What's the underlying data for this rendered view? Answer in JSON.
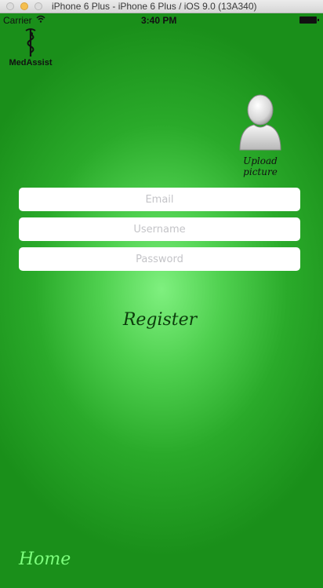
{
  "window": {
    "title": "iPhone 6 Plus - iPhone 6 Plus / iOS 9.0 (13A340)"
  },
  "statusbar": {
    "carrier": "Carrier",
    "wifi_icon": "wifi-icon",
    "time": "3:40 PM",
    "battery_icon": "battery-icon"
  },
  "logo": {
    "text": "MedAssist",
    "icon": "caduceus-icon"
  },
  "avatar": {
    "icon": "user-avatar-icon",
    "label": "Upload picture"
  },
  "form": {
    "email_placeholder": "Email",
    "username_placeholder": "Username",
    "password_placeholder": "Password",
    "register_label": "Register"
  },
  "footer": {
    "home_label": "Home"
  },
  "colors": {
    "background_center": "#7ff07f",
    "background_edge": "#1a8f1a",
    "home_text": "#7dff7d",
    "register_text": "#0c3d0c"
  }
}
